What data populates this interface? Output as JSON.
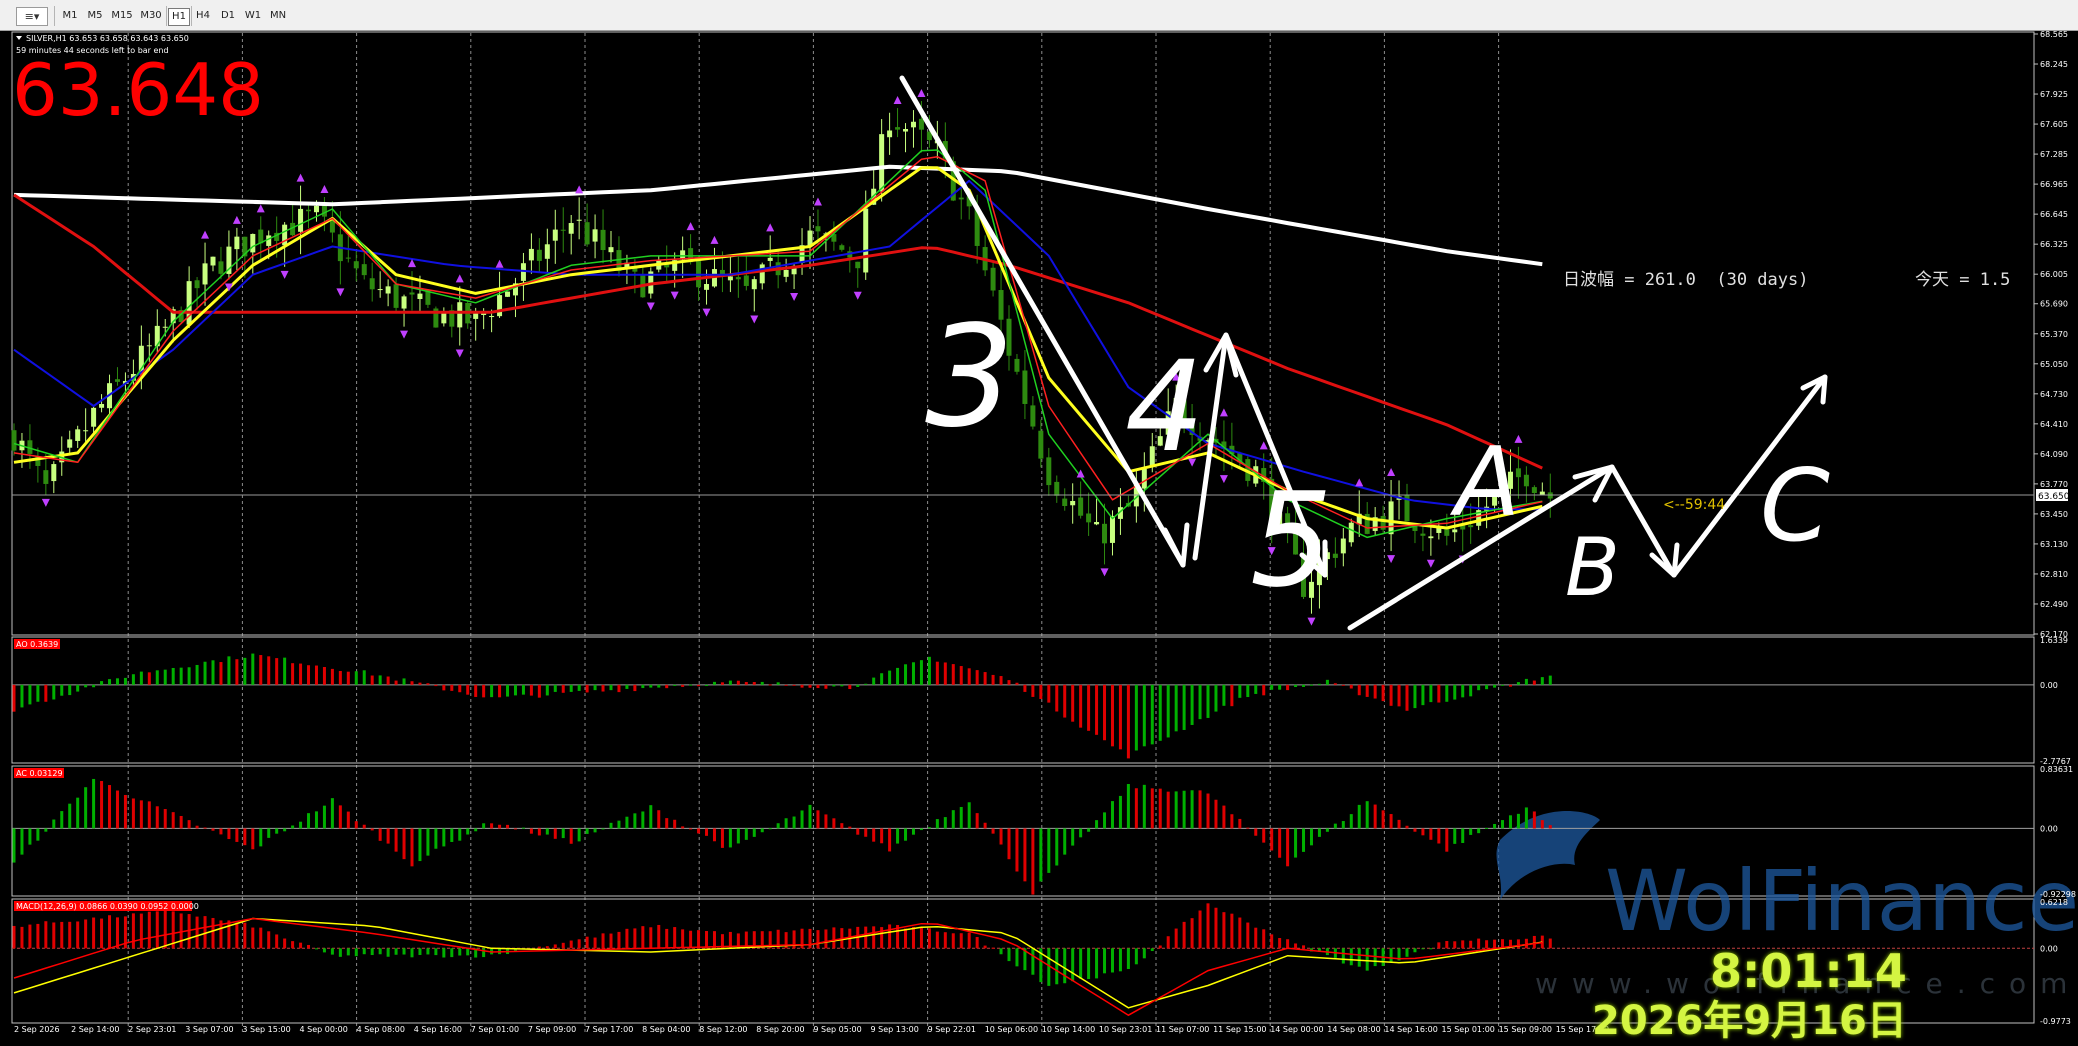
{
  "toolbar": {
    "dropdown_label": "≡▾",
    "timeframes": [
      "M1",
      "M5",
      "M15",
      "M30",
      "H1",
      "H4",
      "D1",
      "W1",
      "MN"
    ],
    "active": "H1"
  },
  "header": {
    "symbol_line": "SILVER,H1  63.653 63.658 63.643 63.650",
    "timer_line": "59 minutes 44 seconds left to bar end",
    "big_price": "63.648"
  },
  "overlay_text": {
    "range_info": "日波幅 = 261.0  (30 days)",
    "today_info": "今天 = 1.5",
    "countdown": "<--59:44",
    "wave_labels": [
      "3",
      "4",
      "5",
      "A",
      "B",
      "C"
    ],
    "watermark": "WolFinance",
    "watermark_sub": "www.wolfinance.com"
  },
  "osd": {
    "time": "8:01:14",
    "date": "2026年9月16日"
  },
  "colors": {
    "bull_candle": "#c8ff80",
    "bear_candle": "#2e8b10",
    "ma_white": "#ffffff",
    "ma_red": "#e01010",
    "ma_blue": "#1010e0",
    "ma_yellow": "#ffff20",
    "ma_green": "#20d020",
    "ma_red_thin": "#ff2020",
    "hist_up": "#00b000",
    "hist_down": "#e00000",
    "macd_signal": "#ffff00",
    "macd_line": "#ff0000",
    "fractal": "#c040ff",
    "annotation": "#ffffff",
    "osd": "#d4f542",
    "big_price": "#ff0000"
  },
  "chart_data": [
    {
      "type": "candlestick",
      "title": "SILVER,H1",
      "last_price": 63.65,
      "ylim": [
        62.17,
        68.565
      ],
      "y_ticks": [
        "68.565",
        "68.245",
        "67.925",
        "67.605",
        "67.285",
        "66.965",
        "66.645",
        "66.325",
        "66.005",
        "65.690",
        "65.370",
        "65.050",
        "64.730",
        "64.410",
        "64.090",
        "63.770",
        "63.450",
        "63.130",
        "62.810",
        "62.490",
        "62.170"
      ],
      "current_price_label": "63.650",
      "x_labels": [
        "2 Sep 2026",
        "2 Sep 14:00",
        "2 Sep 23:01",
        "3 Sep 07:00",
        "3 Sep 15:00",
        "4 Sep 00:00",
        "4 Sep 08:00",
        "4 Sep 16:00",
        "7 Sep 01:00",
        "7 Sep 09:00",
        "7 Sep 17:00",
        "8 Sep 04:00",
        "8 Sep 12:00",
        "8 Sep 20:00",
        "9 Sep 05:00",
        "9 Sep 13:00",
        "9 Sep 22:01",
        "10 Sep 06:00",
        "10 Sep 14:00",
        "10 Sep 23:01",
        "11 Sep 07:00",
        "11 Sep 15:00",
        "14 Sep 00:00",
        "14 Sep 08:00",
        "14 Sep 16:00",
        "15 Sep 01:00",
        "15 Sep 09:00",
        "15 Sep 17:00"
      ],
      "close_path": [
        [
          0,
          64.3
        ],
        [
          4,
          63.7
        ],
        [
          10,
          64.5
        ],
        [
          18,
          65.3
        ],
        [
          25,
          66.1
        ],
        [
          32,
          66.5
        ],
        [
          38,
          66.6
        ],
        [
          44,
          65.9
        ],
        [
          52,
          65.6
        ],
        [
          58,
          65.5
        ],
        [
          66,
          66.2
        ],
        [
          70,
          66.6
        ],
        [
          78,
          65.9
        ],
        [
          84,
          66.1
        ],
        [
          92,
          65.8
        ],
        [
          100,
          66.4
        ],
        [
          106,
          66.2
        ],
        [
          110,
          67.7
        ],
        [
          116,
          67.3
        ],
        [
          120,
          66.6
        ],
        [
          125,
          65.2
        ],
        [
          130,
          63.9
        ],
        [
          136,
          63.2
        ],
        [
          140,
          63.5
        ],
        [
          146,
          64.6
        ],
        [
          150,
          64.3
        ],
        [
          156,
          63.9
        ],
        [
          162,
          62.7
        ],
        [
          168,
          63.3
        ],
        [
          174,
          63.5
        ],
        [
          180,
          63.2
        ],
        [
          186,
          63.6
        ],
        [
          190,
          63.9
        ],
        [
          193,
          63.65
        ]
      ],
      "series": [
        {
          "name": "MA-white",
          "values": [
            [
              0,
              66.85
            ],
            [
              40,
              66.75
            ],
            [
              80,
              66.9
            ],
            [
              110,
              67.15
            ],
            [
              125,
              67.1
            ],
            [
              150,
              66.7
            ],
            [
              180,
              66.25
            ],
            [
              193,
              66.1
            ]
          ]
        },
        {
          "name": "MA-red",
          "values": [
            [
              0,
              66.85
            ],
            [
              10,
              66.3
            ],
            [
              20,
              65.6
            ],
            [
              40,
              65.6
            ],
            [
              60,
              65.6
            ],
            [
              80,
              65.9
            ],
            [
              100,
              66.1
            ],
            [
              115,
              66.3
            ],
            [
              125,
              66.1
            ],
            [
              140,
              65.7
            ],
            [
              160,
              65.0
            ],
            [
              180,
              64.4
            ],
            [
              193,
              63.9
            ]
          ]
        },
        {
          "name": "MA-blue",
          "values": [
            [
              0,
              65.2
            ],
            [
              10,
              64.6
            ],
            [
              20,
              65.2
            ],
            [
              30,
              66.0
            ],
            [
              40,
              66.3
            ],
            [
              55,
              66.1
            ],
            [
              70,
              66.0
            ],
            [
              90,
              66.0
            ],
            [
              110,
              66.3
            ],
            [
              120,
              67.0
            ],
            [
              130,
              66.2
            ],
            [
              140,
              64.8
            ],
            [
              150,
              64.2
            ],
            [
              162,
              63.9
            ],
            [
              175,
              63.6
            ],
            [
              185,
              63.5
            ],
            [
              193,
              63.5
            ]
          ]
        },
        {
          "name": "MA-yellow",
          "values": [
            [
              0,
              64.0
            ],
            [
              8,
              64.1
            ],
            [
              20,
              65.3
            ],
            [
              30,
              66.1
            ],
            [
              40,
              66.6
            ],
            [
              48,
              66.0
            ],
            [
              58,
              65.8
            ],
            [
              70,
              66.0
            ],
            [
              80,
              66.1
            ],
            [
              100,
              66.3
            ],
            [
              115,
              67.2
            ],
            [
              120,
              66.9
            ],
            [
              130,
              64.9
            ],
            [
              140,
              63.9
            ],
            [
              150,
              64.1
            ],
            [
              160,
              63.7
            ],
            [
              170,
              63.4
            ],
            [
              180,
              63.3
            ],
            [
              193,
              63.55
            ]
          ]
        },
        {
          "name": "MA-green",
          "values": [
            [
              0,
              64.2
            ],
            [
              8,
              64.0
            ],
            [
              20,
              65.5
            ],
            [
              30,
              66.3
            ],
            [
              40,
              66.7
            ],
            [
              48,
              65.9
            ],
            [
              58,
              65.7
            ],
            [
              70,
              66.1
            ],
            [
              80,
              66.2
            ],
            [
              100,
              66.2
            ],
            [
              115,
              67.4
            ],
            [
              122,
              66.9
            ],
            [
              130,
              64.3
            ],
            [
              138,
              63.4
            ],
            [
              150,
              64.3
            ],
            [
              160,
              63.6
            ],
            [
              170,
              63.2
            ],
            [
              180,
              63.4
            ],
            [
              193,
              63.6
            ]
          ]
        },
        {
          "name": "MA-red-thin",
          "values": [
            [
              0,
              64.1
            ],
            [
              8,
              64.0
            ],
            [
              20,
              65.4
            ],
            [
              30,
              66.2
            ],
            [
              40,
              66.6
            ],
            [
              48,
              65.9
            ],
            [
              58,
              65.75
            ],
            [
              70,
              66.05
            ],
            [
              80,
              66.15
            ],
            [
              100,
              66.25
            ],
            [
              115,
              67.3
            ],
            [
              122,
              67.0
            ],
            [
              130,
              64.6
            ],
            [
              138,
              63.6
            ],
            [
              150,
              64.2
            ],
            [
              160,
              63.7
            ],
            [
              170,
              63.3
            ],
            [
              180,
              63.35
            ],
            [
              193,
              63.6
            ]
          ]
        }
      ]
    },
    {
      "type": "bar",
      "title": "AO 0.3639",
      "ylim": [
        -2.7767,
        1.6339
      ],
      "y_ticks": [
        "1.6339",
        "0.00",
        "-2.7767"
      ],
      "wave": [
        [
          0,
          -0.9
        ],
        [
          15,
          0.4
        ],
        [
          30,
          1.1
        ],
        [
          45,
          0.4
        ],
        [
          60,
          -0.5
        ],
        [
          75,
          -0.2
        ],
        [
          90,
          0.1
        ],
        [
          105,
          -0.1
        ],
        [
          115,
          1.0
        ],
        [
          125,
          0.2
        ],
        [
          140,
          -2.6
        ],
        [
          155,
          -0.4
        ],
        [
          165,
          0.1
        ],
        [
          175,
          -0.9
        ],
        [
          185,
          -0.2
        ],
        [
          193,
          0.36
        ]
      ]
    },
    {
      "type": "bar",
      "title": "AC 0.03129",
      "ylim": [
        -0.92298,
        0.83631
      ],
      "y_ticks": [
        "0.83631",
        "0.00",
        "-0.92298"
      ],
      "wave": [
        [
          0,
          -0.5
        ],
        [
          10,
          0.7
        ],
        [
          20,
          0.2
        ],
        [
          30,
          -0.3
        ],
        [
          40,
          0.4
        ],
        [
          50,
          -0.5
        ],
        [
          60,
          0.1
        ],
        [
          70,
          -0.2
        ],
        [
          80,
          0.3
        ],
        [
          90,
          -0.3
        ],
        [
          100,
          0.3
        ],
        [
          110,
          -0.3
        ],
        [
          120,
          0.4
        ],
        [
          128,
          -0.9
        ],
        [
          140,
          0.6
        ],
        [
          150,
          0.5
        ],
        [
          160,
          -0.5
        ],
        [
          170,
          0.4
        ],
        [
          180,
          -0.3
        ],
        [
          190,
          0.3
        ],
        [
          193,
          0.03
        ]
      ]
    },
    {
      "type": "bar",
      "title": "MACD(12,26,9) 0.0866 0.0390 0.0952 0.0000",
      "ylim": [
        -0.9773,
        0.6218
      ],
      "y_ticks": [
        "0.6218",
        "0.00",
        "-0.9773"
      ],
      "wave": [
        [
          0,
          0.3
        ],
        [
          10,
          0.4
        ],
        [
          20,
          0.5
        ],
        [
          30,
          0.3
        ],
        [
          40,
          -0.1
        ],
        [
          60,
          -0.1
        ],
        [
          80,
          0.3
        ],
        [
          90,
          0.2
        ],
        [
          110,
          0.3
        ],
        [
          120,
          0.2
        ],
        [
          130,
          -0.5
        ],
        [
          140,
          -0.3
        ],
        [
          150,
          0.6
        ],
        [
          160,
          0.1
        ],
        [
          170,
          -0.3
        ],
        [
          180,
          0.1
        ],
        [
          193,
          0.15
        ]
      ],
      "series": [
        {
          "name": "signal",
          "values": [
            [
              0,
              -0.6
            ],
            [
              15,
              -0.1
            ],
            [
              30,
              0.4
            ],
            [
              45,
              0.3
            ],
            [
              60,
              0.0
            ],
            [
              80,
              -0.05
            ],
            [
              100,
              0.05
            ],
            [
              115,
              0.3
            ],
            [
              125,
              0.2
            ],
            [
              140,
              -0.8
            ],
            [
              150,
              -0.5
            ],
            [
              160,
              -0.1
            ],
            [
              175,
              -0.2
            ],
            [
              193,
              0.1
            ]
          ]
        },
        {
          "name": "main",
          "values": [
            [
              0,
              -0.4
            ],
            [
              15,
              0.1
            ],
            [
              30,
              0.4
            ],
            [
              45,
              0.2
            ],
            [
              60,
              -0.05
            ],
            [
              80,
              0.0
            ],
            [
              100,
              0.05
            ],
            [
              115,
              0.35
            ],
            [
              125,
              0.1
            ],
            [
              140,
              -0.9
            ],
            [
              150,
              -0.3
            ],
            [
              160,
              0.0
            ],
            [
              175,
              -0.15
            ],
            [
              193,
              0.09
            ]
          ]
        }
      ]
    }
  ]
}
